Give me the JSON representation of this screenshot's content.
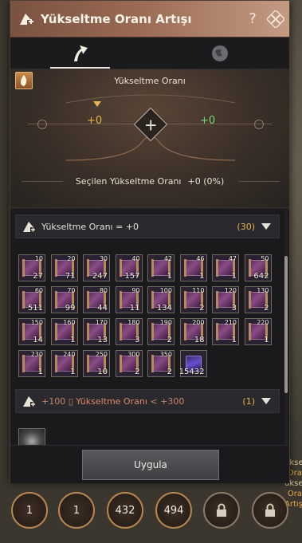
{
  "window": {
    "title": "Yükseltme Oranı Artışı",
    "help_label": "?"
  },
  "tabs": [
    {
      "icon": "upgrade-arrow-icon",
      "active": true
    },
    {
      "icon": "globe-icon",
      "active": false
    }
  ],
  "rate_panel": {
    "title": "Yükseltme Oranı",
    "current_value": "+0",
    "added_value": "+0",
    "selected_label": "Seçilen Yükseltme Oranı",
    "selected_value": "+0 (0%)"
  },
  "groups": [
    {
      "label": "Yükseltme Oranı = +0",
      "count": "(30)"
    },
    {
      "label_prefix": "+100",
      "label_mid": "Yükseltme Oranı",
      "label_suffix": "< +300",
      "count": "(1)"
    }
  ],
  "items": [
    {
      "level": "10",
      "count": "27"
    },
    {
      "level": "20",
      "count": "71"
    },
    {
      "level": "30",
      "count": "247"
    },
    {
      "level": "40",
      "count": "157"
    },
    {
      "level": "42",
      "count": "1"
    },
    {
      "level": "46",
      "count": "1"
    },
    {
      "level": "47",
      "count": "1"
    },
    {
      "level": "50",
      "count": "642"
    },
    {
      "level": "60",
      "count": "511"
    },
    {
      "level": "70",
      "count": "99"
    },
    {
      "level": "80",
      "count": "44"
    },
    {
      "level": "90",
      "count": "11"
    },
    {
      "level": "100",
      "count": "134"
    },
    {
      "level": "110",
      "count": "2"
    },
    {
      "level": "120",
      "count": "3"
    },
    {
      "level": "130",
      "count": "2"
    },
    {
      "level": "150",
      "count": "14"
    },
    {
      "level": "160",
      "count": "1"
    },
    {
      "level": "170",
      "count": "13"
    },
    {
      "level": "180",
      "count": "3"
    },
    {
      "level": "190",
      "count": "2"
    },
    {
      "level": "200",
      "count": "18"
    },
    {
      "level": "210",
      "count": "1"
    },
    {
      "level": "220",
      "count": "1"
    },
    {
      "level": "230",
      "count": "1"
    },
    {
      "level": "240",
      "count": "1"
    },
    {
      "level": "250",
      "count": "10"
    },
    {
      "level": "300",
      "count": "2"
    },
    {
      "level": "350",
      "count": "2"
    },
    {
      "level": "",
      "count": "15432",
      "special": true
    }
  ],
  "apply_label": "Uygula",
  "bottom_slots": [
    "1",
    "1",
    "432",
    "494",
    "",
    ""
  ],
  "side_text": {
    "line1": "ükse",
    "line2": "Ora",
    "line3": "ükse",
    "line4": "Ora",
    "line5": "Artış"
  },
  "colors": {
    "title_bar": "#9a6a53",
    "accent_gold": "#e3b446",
    "added_green": "#76d77a"
  }
}
